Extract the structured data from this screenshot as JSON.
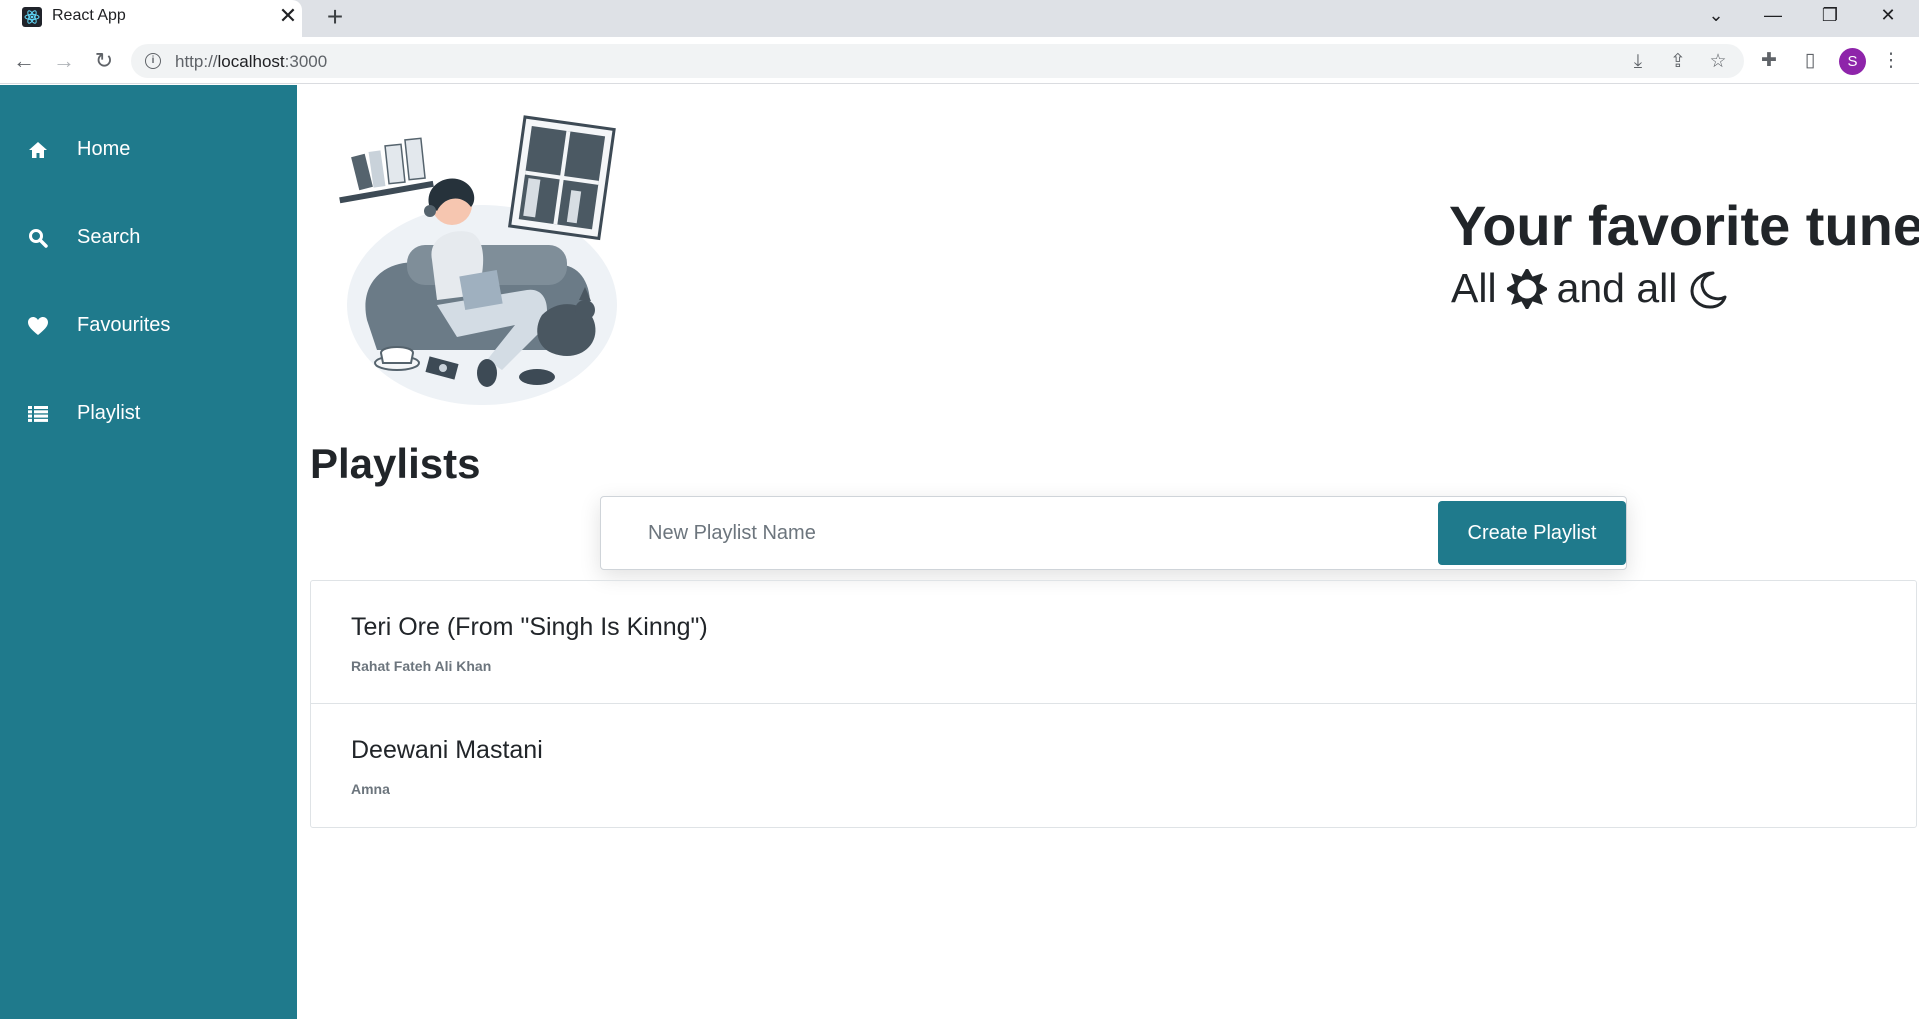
{
  "browser": {
    "tab_title": "React App",
    "tab_close": "✕",
    "new_tab": "+",
    "url_scheme": "http://",
    "url_host": "localhost",
    "url_port": ":3000",
    "profile_initial": "S"
  },
  "sidebar": {
    "items": [
      {
        "label": "Home",
        "icon": "home-icon"
      },
      {
        "label": "Search",
        "icon": "search-icon"
      },
      {
        "label": "Favourites",
        "icon": "heart-icon"
      },
      {
        "label": "Playlist",
        "icon": "list-icon"
      }
    ]
  },
  "hero": {
    "title": "Your favorite tunes",
    "subtitle_start": "All",
    "subtitle_middle": "and all",
    "icons": [
      "sun-icon",
      "moon-icon"
    ]
  },
  "playlists": {
    "heading": "Playlists",
    "new_placeholder": "New Playlist Name",
    "create_label": "Create Playlist",
    "tracks": [
      {
        "title": "Teri Ore (From \"Singh Is Kinng\")",
        "artist": "Rahat Fateh Ali Khan"
      },
      {
        "title": "Deewani Mastani",
        "artist": "Amna"
      }
    ]
  },
  "colors": {
    "sidebar": "#1f7a8c",
    "button": "#1f7a8c",
    "text": "#212529"
  }
}
